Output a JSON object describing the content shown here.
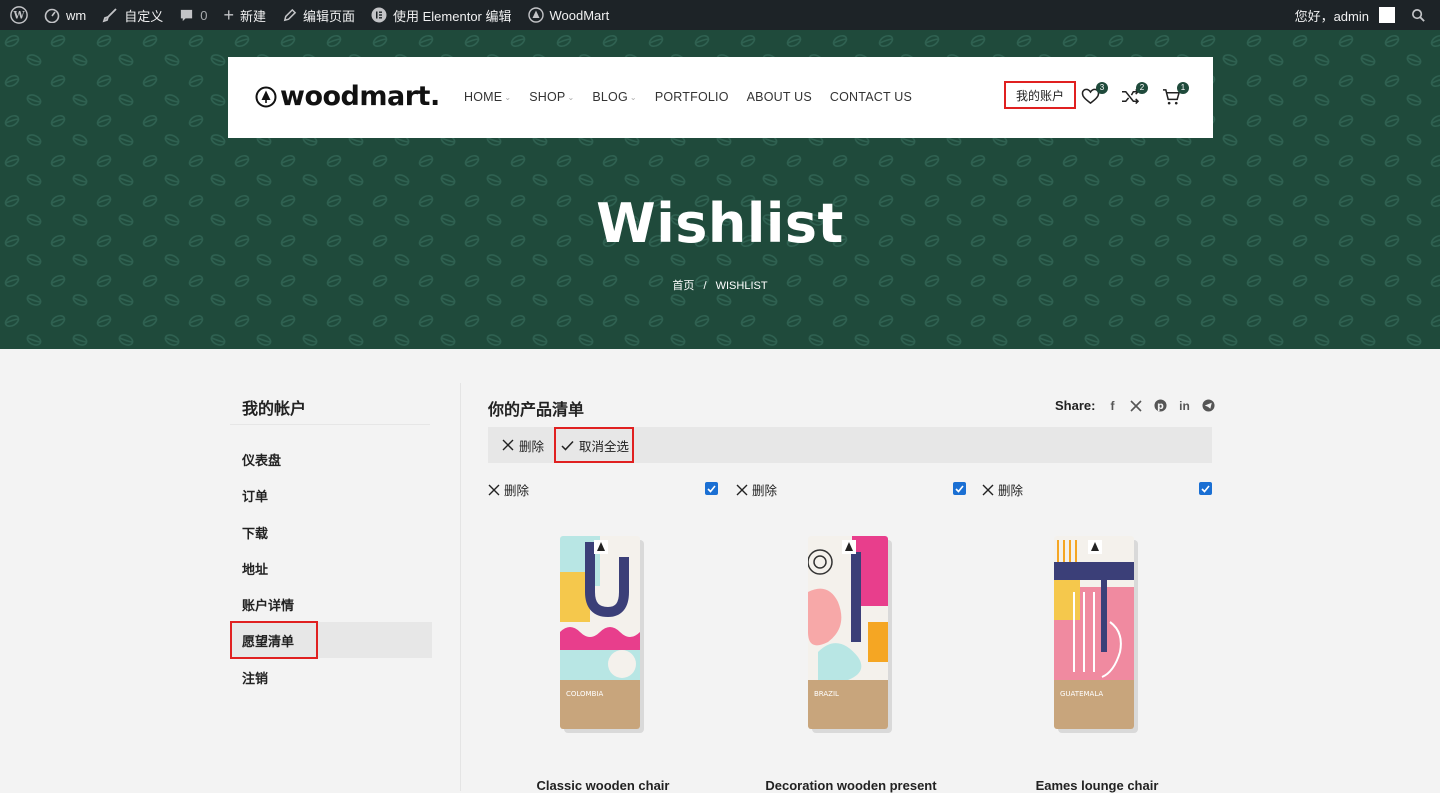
{
  "adminbar": {
    "site": "wm",
    "customize": "自定义",
    "comments": "0",
    "new": "新建",
    "edit_page": "编辑页面",
    "elementor": "使用 Elementor 编辑",
    "woodmart": "WoodMart",
    "greeting": "您好，admin"
  },
  "header": {
    "logo": "woodmart.",
    "nav": [
      {
        "label": "HOME",
        "dropdown": true
      },
      {
        "label": "SHOP",
        "dropdown": true
      },
      {
        "label": "BLOG",
        "dropdown": true
      },
      {
        "label": "PORTFOLIO",
        "dropdown": false
      },
      {
        "label": "ABOUT US",
        "dropdown": false
      },
      {
        "label": "CONTACT US",
        "dropdown": false
      }
    ],
    "account": "我的账户",
    "wishlist_count": "3",
    "compare_count": "2",
    "cart_count": "1",
    "chevron": "⌄"
  },
  "hero": {
    "title": "Wishlist",
    "crumb_home": "首页",
    "crumb_sep": "/",
    "crumb_current": "WISHLIST"
  },
  "sidebar": {
    "title": "我的帐户",
    "items": [
      "仪表盘",
      "订单",
      "下载",
      "地址",
      "账户详情",
      "愿望清单",
      "注销"
    ]
  },
  "wishlist": {
    "title": "你的产品清单",
    "share_label": "Share:",
    "share_icons": [
      "facebook-icon",
      "x-icon",
      "pinterest-icon",
      "linkedin-icon",
      "telegram-icon"
    ],
    "bulk_remove": "删除",
    "bulk_deselect": "取消全选",
    "products": [
      {
        "remove": "删除",
        "checked": true,
        "name": "Classic wooden chair",
        "label": "COLOMBIA"
      },
      {
        "remove": "删除",
        "checked": true,
        "name": "Decoration wooden present",
        "label": "BRAZIL"
      },
      {
        "remove": "删除",
        "checked": true,
        "name": "Eames lounge chair",
        "label": "GUATEMALA"
      }
    ]
  },
  "colors": {
    "hero_bg": "#1f4a3b",
    "highlight": "#e02020",
    "checkbox": "#1a6fd3",
    "adminbar": "#1d2327"
  }
}
